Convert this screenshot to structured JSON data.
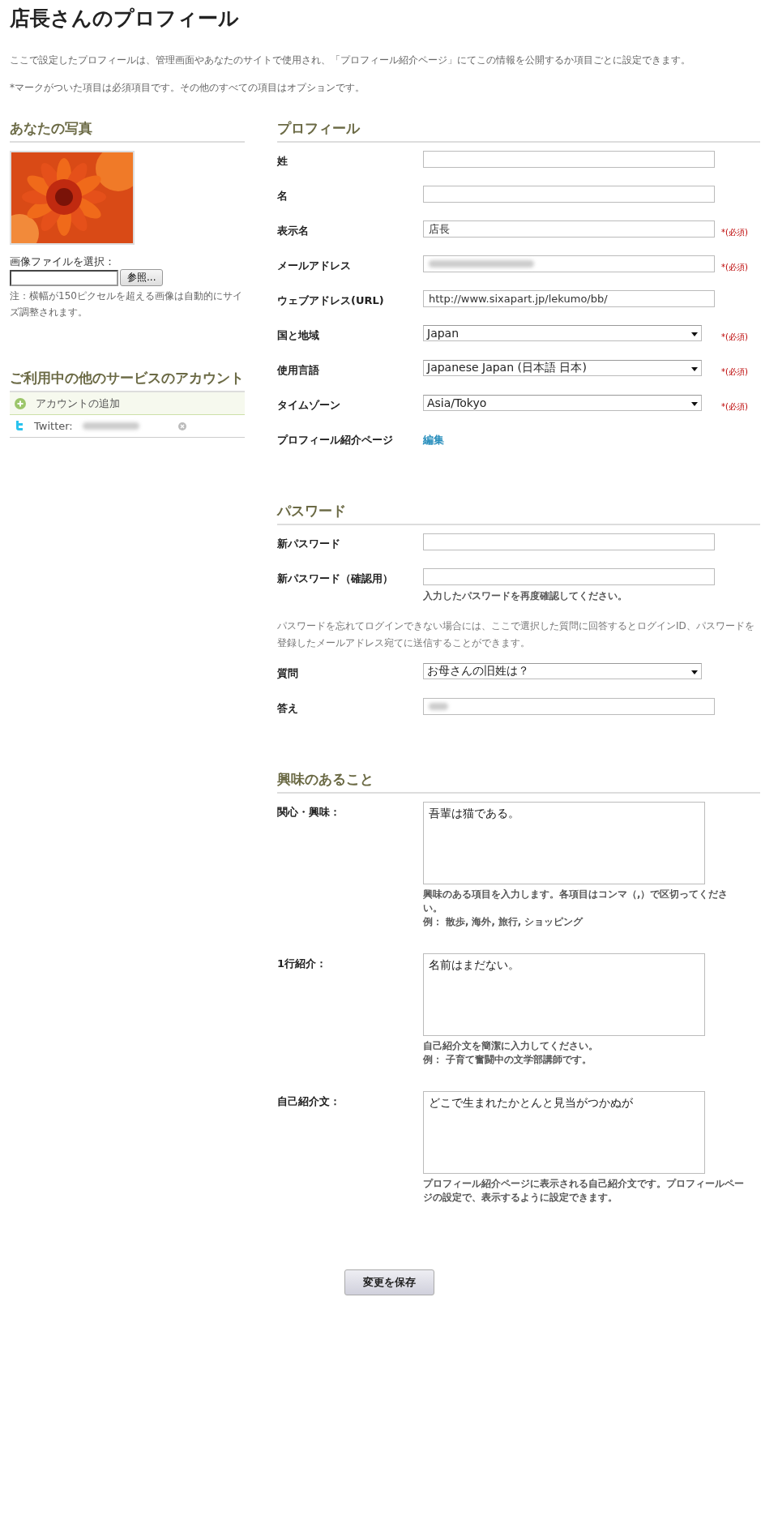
{
  "page": {
    "title": "店長さんのプロフィール",
    "intro": [
      "ここで設定したプロフィールは、管理画面やあなたのサイトで使用され、「プロフィール紹介ページ」にてこの情報を公開するか項目ごとに設定できます。",
      "*マークがついた項目は必須項目です。その他のすべての項目はオプションです。"
    ]
  },
  "photo_section": {
    "heading": "あなたの写真",
    "file_label": "画像ファイルを選択：",
    "browse_button": "参照...",
    "note": "注：横幅が150ピクセルを超える画像は自動的にサイズ調整されます。"
  },
  "accounts": {
    "heading": "ご利用中の他のサービスのアカウント",
    "items": [
      {
        "kind": "add",
        "label": "アカウントの追加",
        "blurred": false
      },
      {
        "kind": "twitter",
        "label": "Twitter:",
        "blurred": true
      }
    ]
  },
  "sections": [
    {
      "heading": "プロフィール",
      "fields": [
        {
          "kind": "text",
          "label": "姓"
        },
        {
          "kind": "text",
          "label": "名"
        },
        {
          "kind": "text",
          "label": "表示名",
          "value": "店長",
          "required": "*(必須)"
        },
        {
          "kind": "text",
          "label": "メールアドレス",
          "blurred": true,
          "required": "*(必須)"
        },
        {
          "kind": "text",
          "label": "ウェブアドレス(URL)",
          "value": "http://www.sixapart.jp/lekumo/bb/"
        },
        {
          "kind": "select",
          "label": "国と地域",
          "value": "Japan",
          "required": "*(必須)"
        },
        {
          "kind": "select",
          "label": "使用言語",
          "value": "Japanese Japan (日本語 日本)",
          "required": "*(必須)"
        },
        {
          "kind": "select",
          "label": "タイムゾーン",
          "value": "Asia/Tokyo",
          "required": "*(必須)"
        },
        {
          "kind": "link",
          "label": "プロフィール紹介ページ",
          "value": "編集"
        }
      ]
    },
    {
      "heading": "パスワード",
      "fields": [
        {
          "kind": "text",
          "label": "新パスワード"
        },
        {
          "kind": "text",
          "label": "新パスワード（確認用）",
          "hints": [
            "入力したパスワードを再度確認してください。"
          ]
        },
        {
          "kind": "note",
          "value": "パスワードを忘れてログインできない場合には、ここで選択した質問に回答するとログインID、パスワードを登録したメールアドレス宛てに送信することができます。"
        },
        {
          "kind": "select",
          "label": "質問",
          "value": "お母さんの旧姓は？"
        },
        {
          "kind": "text",
          "label": "答え",
          "blurred": true
        }
      ]
    },
    {
      "heading": "興味のあること",
      "fields": [
        {
          "kind": "textarea",
          "label": "関心・興味：",
          "value": "吾輩は猫である。",
          "hints": [
            "興味のある項目を入力します。各項目はコンマ（,）で区切ってください。",
            "例： 散歩, 海外, 旅行, ショッピング"
          ]
        },
        {
          "kind": "textarea",
          "label": "1行紹介：",
          "value": "名前はまだない。",
          "hints": [
            "自己紹介文を簡潔に入力してください。",
            "例： 子育て奮闘中の文学部講師です。"
          ]
        },
        {
          "kind": "textarea",
          "label": "自己紹介文：",
          "value": "どこで生まれたかとんと見当がつかぬが",
          "hints": [
            "プロフィール紹介ページに表示される自己紹介文です。プロフィールページの設定で、表示するように設定できます。"
          ]
        }
      ]
    }
  ],
  "save_button": "変更を保存"
}
